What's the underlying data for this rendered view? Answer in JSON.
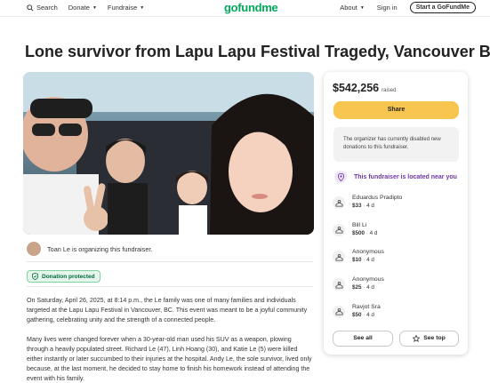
{
  "header": {
    "search_label": "Search",
    "donate_label": "Donate",
    "fundraise_label": "Fundraise",
    "logo_text": "gofundme",
    "about_label": "About",
    "signin_label": "Sign in",
    "start_label": "Start a GoFundMe"
  },
  "page": {
    "title": "Lone survivor from Lapu Lapu Festival Tragedy, Vancouver BC",
    "organizer_text": "Toan Le is organizing this fundraiser.",
    "protected_label": "Donation protected",
    "story": [
      "On Saturday, April 26, 2025, at 8:14 p.m., the Le family was one of many families and individuals targeted at the Lapu Lapu Festival in Vancouver, BC. This event was meant to be a joyful community gathering, celebrating unity and the strength of a connected people.",
      "Many lives were changed forever when a 30-year-old man used his SUV as a weapon, plowing through a heavily populated street. Richard Le (47), Linh Hoang (30), and Katie Le (5) were killed either instantly or later succumbed to their injuries at the hospital. Andy Le, the sole survivor, lived only because, at the last moment, he decided to stay home to finish his homework instead of attending the event with his family."
    ]
  },
  "sidebar": {
    "amount": "$542,256",
    "amount_label": "raised",
    "share_label": "Share",
    "notice": "The organizer has currently disabled new donations to this fundraiser.",
    "near_label": "This fundraiser is located near you",
    "donations": [
      {
        "name": "Eduardus Pradipto",
        "amount": "$33",
        "time": "4 d"
      },
      {
        "name": "Bill Li",
        "amount": "$500",
        "time": "4 d"
      },
      {
        "name": "Anonymous",
        "amount": "$10",
        "time": "4 d"
      },
      {
        "name": "Anonymous",
        "amount": "$25",
        "time": "4 d"
      },
      {
        "name": "Ravjot Sra",
        "amount": "$50",
        "time": "4 d"
      }
    ],
    "see_all_label": "See all",
    "see_top_label": "See top"
  },
  "colors": {
    "brand_green": "#02a95c",
    "share_yellow": "#f8c64e",
    "near_purple": "#6e34a6"
  }
}
